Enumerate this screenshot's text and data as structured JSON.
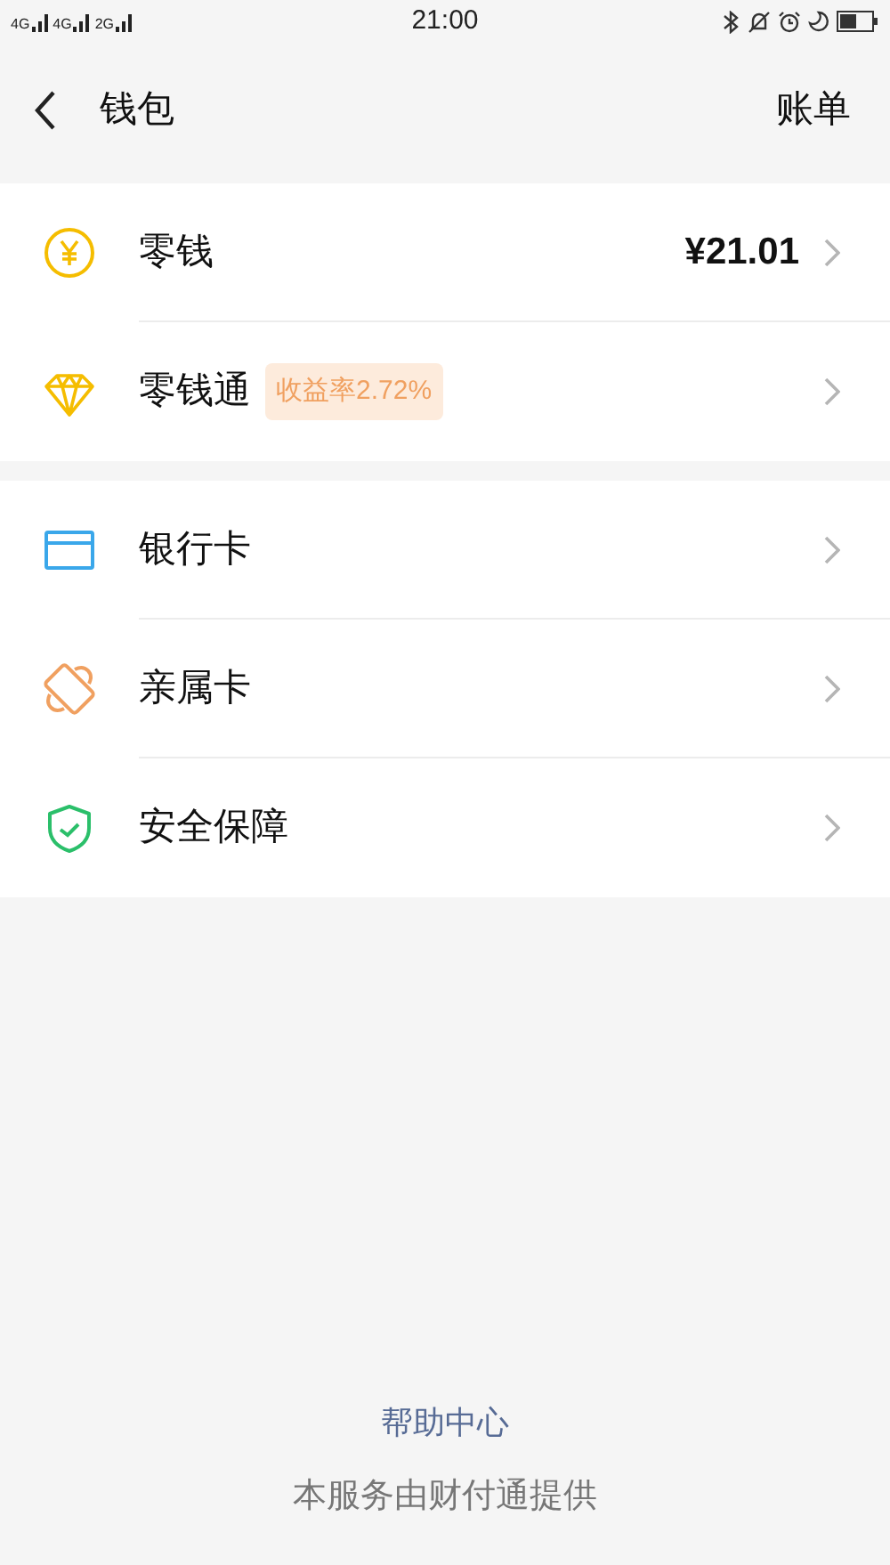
{
  "status_bar": {
    "network_labels": [
      "4G",
      "4G",
      "2G"
    ],
    "time": "21:00"
  },
  "header": {
    "title": "钱包",
    "action": "账单"
  },
  "sections": [
    {
      "items": [
        {
          "kind": "yen",
          "label": "零钱",
          "value": "¥21.01"
        },
        {
          "kind": "diamond",
          "label": "零钱通",
          "badge": "收益率2.72%"
        }
      ]
    },
    {
      "items": [
        {
          "kind": "card",
          "label": "银行卡"
        },
        {
          "kind": "family",
          "label": "亲属卡"
        },
        {
          "kind": "shield",
          "label": "安全保障"
        }
      ]
    }
  ],
  "footer": {
    "link": "帮助中心",
    "note": "本服务由财付通提供"
  }
}
